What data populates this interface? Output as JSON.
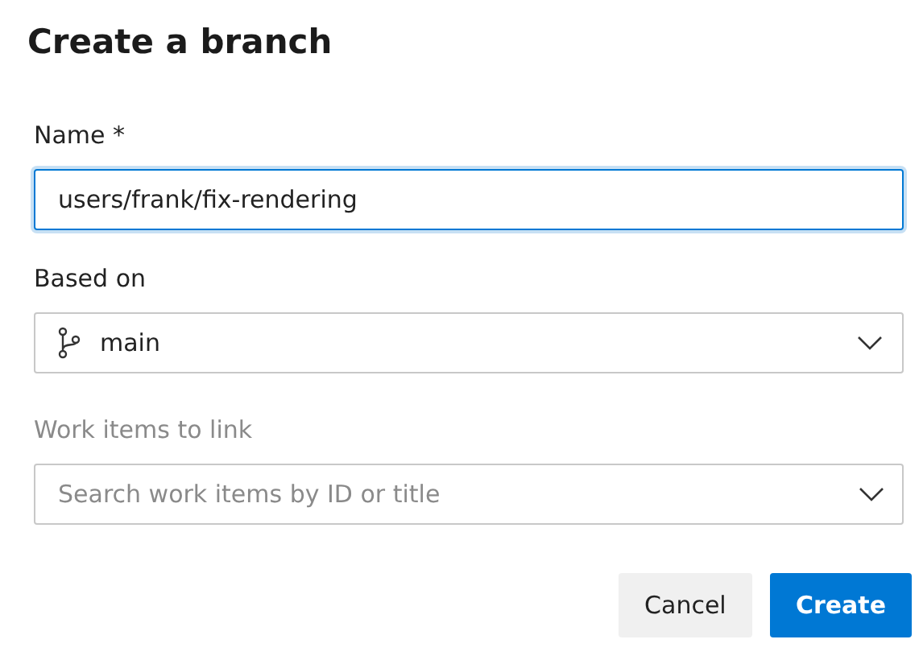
{
  "dialog": {
    "title": "Create a branch"
  },
  "name_field": {
    "label": "Name *",
    "value": "users/frank/fix-rendering",
    "focused": true
  },
  "based_on": {
    "label": "Based on",
    "value": "main"
  },
  "work_items": {
    "label": "Work items to link",
    "placeholder": "Search work items by ID or title",
    "disabled": true
  },
  "buttons": [
    {
      "label": "Cancel",
      "kind": "secondary"
    },
    {
      "label": "Create",
      "kind": "primary"
    }
  ]
}
